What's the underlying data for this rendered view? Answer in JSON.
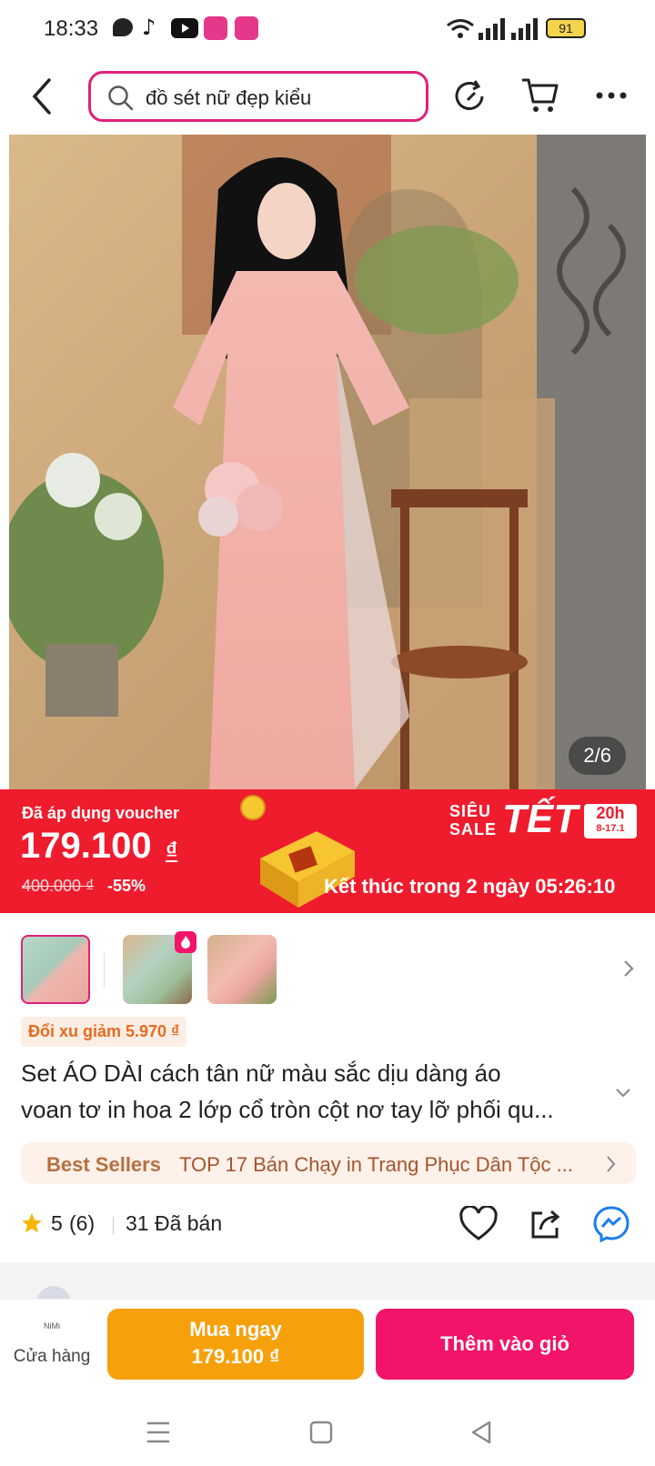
{
  "status_bar": {
    "time": "18:33",
    "app_icons": [
      "chat-icon",
      "tiktok-icon",
      "youtube-icon",
      "lazada-icon",
      "lazada-icon"
    ],
    "battery": "91"
  },
  "top_bar": {
    "search_query": "đồ sét nữ đẹp kiểu"
  },
  "gallery": {
    "counter": "2/6"
  },
  "promo": {
    "voucher_label": "Đã áp dụng voucher",
    "price": "179.100",
    "currency": "₫",
    "original_price": "400.000 ₫",
    "discount": "-55%",
    "sale_line1": "SIÊU",
    "sale_line2": "SALE",
    "sale_brand": "TẾT",
    "sale_badge_hour": "20h",
    "sale_badge_date": "8-17.1",
    "countdown": "Kết thúc trong 2 ngày 05:26:10",
    "colors": {
      "banner": "#ef1c2e"
    }
  },
  "product": {
    "coin_tag": "Đổi xu giảm 5.970 ₫",
    "title_line1": "Set ÁO DÀI cách tân nữ màu sắc dịu dàng áo",
    "title_line2": "voan tơ in hoa 2 lớp cổ tròn cột nơ tay lỡ phối qu...",
    "best_seller_label": "Best Sellers",
    "best_seller_text": "TOP 17 Bán Chạy in Trang Phục Dân Tộc ...",
    "rating": "5",
    "rating_count": "(6)",
    "sold": "31 Đã bán"
  },
  "bottom_bar": {
    "store_label": "Cửa hàng",
    "store_logo": "NiMi",
    "buy_now_label": "Mua ngay",
    "buy_now_price": "179.100 ₫",
    "add_to_cart_label": "Thêm vào giỏ",
    "colors": {
      "buy_now": "#f6a00c",
      "add_to_cart": "#f2136a"
    }
  }
}
